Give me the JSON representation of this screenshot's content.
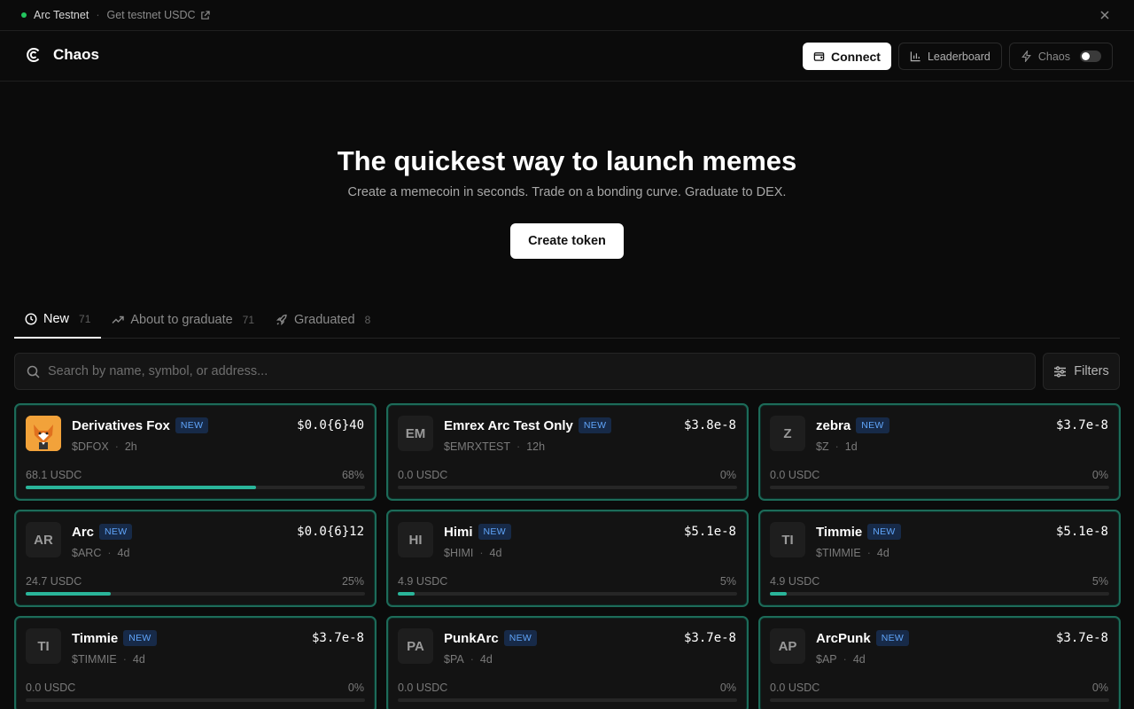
{
  "banner": {
    "network": "Arc Testnet",
    "separator": "·",
    "faucet_link": "Get testnet USDC"
  },
  "header": {
    "brand": "Chaos",
    "connect_label": "Connect",
    "leaderboard_label": "Leaderboard",
    "mode_label": "Chaos"
  },
  "hero": {
    "title": "The quickest way to launch memes",
    "subtitle": "Create a memecoin in seconds. Trade on a bonding curve. Graduate to DEX.",
    "create_label": "Create token"
  },
  "tabs": [
    {
      "label": "New",
      "count": "71",
      "active": true
    },
    {
      "label": "About to graduate",
      "count": "71",
      "active": false
    },
    {
      "label": "Graduated",
      "count": "8",
      "active": false
    }
  ],
  "search": {
    "placeholder": "Search by name, symbol, or address...",
    "filters_label": "Filters"
  },
  "badge_label": "NEW",
  "tokens": [
    {
      "initials": "",
      "has_image": true,
      "name": "Derivatives Fox",
      "symbol": "$DFOX",
      "age": "2h",
      "price": "$0.0{6}40",
      "raised": "68.1 USDC",
      "progress_label": "68%",
      "progress": 0.68
    },
    {
      "initials": "EM",
      "has_image": false,
      "name": "Emrex Arc Test Only",
      "symbol": "$EMRXTEST",
      "age": "12h",
      "price": "$3.8e-8",
      "raised": "0.0 USDC",
      "progress_label": "0%",
      "progress": 0
    },
    {
      "initials": "Z",
      "has_image": false,
      "name": "zebra",
      "symbol": "$Z",
      "age": "1d",
      "price": "$3.7e-8",
      "raised": "0.0 USDC",
      "progress_label": "0%",
      "progress": 0
    },
    {
      "initials": "AR",
      "has_image": false,
      "name": "Arc",
      "symbol": "$ARC",
      "age": "4d",
      "price": "$0.0{6}12",
      "raised": "24.7 USDC",
      "progress_label": "25%",
      "progress": 0.25
    },
    {
      "initials": "HI",
      "has_image": false,
      "name": "Himi",
      "symbol": "$HIMI",
      "age": "4d",
      "price": "$5.1e-8",
      "raised": "4.9 USDC",
      "progress_label": "5%",
      "progress": 0.05
    },
    {
      "initials": "TI",
      "has_image": false,
      "name": "Timmie",
      "symbol": "$TIMMIE",
      "age": "4d",
      "price": "$5.1e-8",
      "raised": "4.9 USDC",
      "progress_label": "5%",
      "progress": 0.05
    },
    {
      "initials": "TI",
      "has_image": false,
      "name": "Timmie",
      "symbol": "$TIMMIE",
      "age": "4d",
      "price": "$3.7e-8",
      "raised": "0.0 USDC",
      "progress_label": "0%",
      "progress": 0
    },
    {
      "initials": "PA",
      "has_image": false,
      "name": "PunkArc",
      "symbol": "$PA",
      "age": "4d",
      "price": "$3.7e-8",
      "raised": "0.0 USDC",
      "progress_label": "0%",
      "progress": 0
    },
    {
      "initials": "AP",
      "has_image": false,
      "name": "ArcPunk",
      "symbol": "$AP",
      "age": "4d",
      "price": "$3.7e-8",
      "raised": "0.0 USDC",
      "progress_label": "0%",
      "progress": 0
    }
  ],
  "colors": {
    "accent": "#2ab59a",
    "card_border": "#1d6b59",
    "badge_text": "#60a5fa",
    "status_dot": "#22c55e"
  }
}
